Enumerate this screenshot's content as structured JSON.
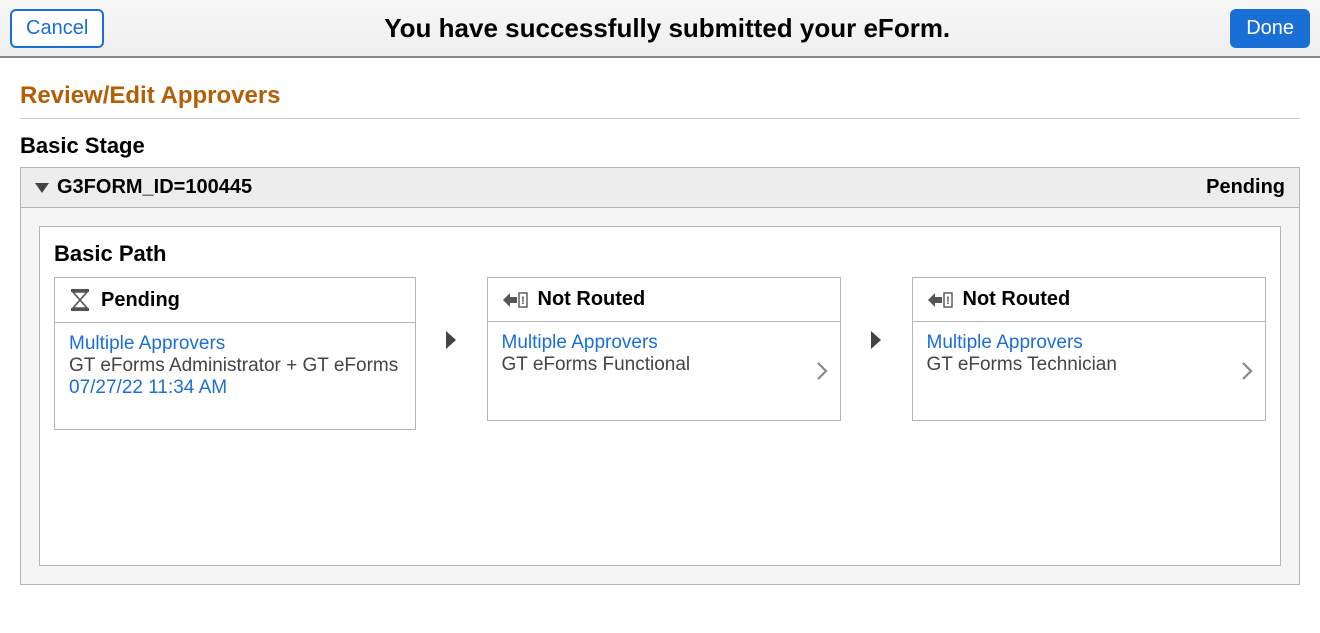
{
  "header": {
    "cancel": "Cancel",
    "title": "You have successfully submitted your eForm.",
    "done": "Done"
  },
  "section": {
    "title": "Review/Edit Approvers"
  },
  "stage": {
    "title": "Basic Stage",
    "formId": "G3FORM_ID=100445",
    "status": "Pending"
  },
  "path": {
    "title": "Basic Path",
    "steps": [
      {
        "status": "Pending",
        "link": "Multiple Approvers",
        "role": "GT eForms Administrator + GT eForms D",
        "timestamp": "07/27/22 11:34 AM"
      },
      {
        "status": "Not Routed",
        "link": "Multiple Approvers",
        "role": "GT eForms Functional",
        "timestamp": ""
      },
      {
        "status": "Not Routed",
        "link": "Multiple Approvers",
        "role": "GT eForms Technician",
        "timestamp": ""
      }
    ]
  }
}
